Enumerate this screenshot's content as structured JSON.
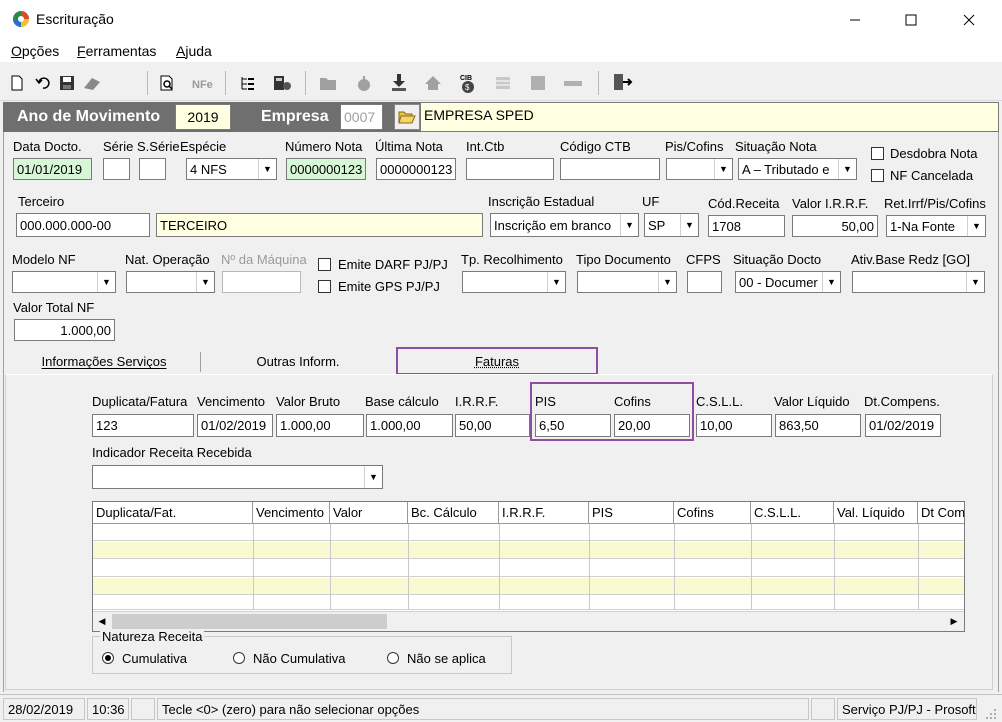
{
  "window": {
    "title": "Escrituração"
  },
  "menu": [
    {
      "label": "Opções",
      "accel": "O"
    },
    {
      "label": "Ferramentas",
      "accel": "F"
    },
    {
      "label": "Ajuda",
      "accel": "A"
    }
  ],
  "header": {
    "ano_label": "Ano de Movimento",
    "ano_value": "2019",
    "empresa_label": "Empresa",
    "empresa_code": "0007",
    "empresa_name": "EMPRESA SPED"
  },
  "row1": {
    "data_docto_label": "Data Docto.",
    "data_docto": "01/01/2019",
    "serie_label": "Série",
    "serie": "",
    "sserie_label": "S.Série",
    "sserie": "",
    "especie_label": "Espécie",
    "especie": "4 NFS",
    "numero_nota_label": "Número Nota",
    "numero_nota": "0000000123",
    "ultima_nota_label": "Última Nota",
    "ultima_nota": "0000000123",
    "int_ctb_label": "Int.Ctb",
    "int_ctb": "",
    "codigo_ctb_label": "Código CTB",
    "codigo_ctb": "",
    "pis_cofins_label": "Pis/Cofins",
    "pis_cofins": "",
    "situacao_nota_label": "Situação Nota",
    "situacao_nota": "A – Tributado e",
    "desdobra_label": "Desdobra Nota",
    "nf_cancelada_label": "NF Cancelada"
  },
  "row2": {
    "terceiro_label": "Terceiro",
    "terceiro_doc": "000.000.000-00",
    "terceiro_nome": "TERCEIRO",
    "insc_est_label": "Inscrição Estadual",
    "insc_est": "Inscrição em branco",
    "uf_label": "UF",
    "uf": "SP",
    "cod_receita_label": "Cód.Receita",
    "cod_receita": "1708",
    "valor_irrf_label": "Valor I.R.R.F.",
    "valor_irrf": "50,00",
    "ret_irrf_label": "Ret.Irrf/Pis/Cofins",
    "ret_irrf": "1-Na Fonte"
  },
  "row3": {
    "modelo_nf_label": "Modelo NF",
    "modelo_nf": "",
    "nat_operacao_label": "Nat. Operação",
    "nat_operacao": "",
    "n_maquina_label": "Nº da Máquina",
    "n_maquina": "",
    "emite_darf_label": "Emite DARF PJ/PJ",
    "emite_gps_label": "Emite GPS PJ/PJ",
    "tp_recolhimento_label": "Tp. Recolhimento",
    "tp_recolhimento": "",
    "tipo_documento_label": "Tipo Documento",
    "tipo_documento": "",
    "cfps_label": "CFPS",
    "cfps": "",
    "situacao_docto_label": "Situação Docto",
    "situacao_docto": "00 - Documer",
    "ativ_base_label": "Ativ.Base Redz [GO]",
    "ativ_base": ""
  },
  "row4": {
    "valor_total_label": "Valor Total NF",
    "valor_total": "1.000,00"
  },
  "tabs": [
    {
      "label": "Informações Serviços",
      "accel_index": 0
    },
    {
      "label": "Outras Inform.",
      "accel_index": 0
    },
    {
      "label": "Faturas",
      "accel_index": 0
    }
  ],
  "faturas": {
    "duplicata_label": "Duplicata/Fatura",
    "duplicata": "123",
    "vencimento_label": "Vencimento",
    "vencimento": "01/02/2019",
    "valor_bruto_label": "Valor Bruto",
    "valor_bruto": "1.000,00",
    "base_calculo_label": "Base cálculo",
    "base_calculo": "1.000,00",
    "irrf_label": "I.R.R.F.",
    "irrf": "50,00",
    "pis_label": "PIS",
    "pis": "6,50",
    "cofins_label": "Cofins",
    "cofins": "20,00",
    "csll_label": "C.S.L.L.",
    "csll": "10,00",
    "valor_liquido_label": "Valor Líquido",
    "valor_liquido": "863,50",
    "dt_compens_label": "Dt.Compens.",
    "dt_compens": "01/02/2019",
    "indicador_label": "Indicador Receita Recebida",
    "indicador": ""
  },
  "grid": {
    "columns": [
      "Duplicata/Fat.",
      "Vencimento",
      "Valor",
      "Bc. Cálculo",
      "I.R.R.F.",
      "PIS",
      "Cofins",
      "C.S.L.L.",
      "Val. Líquido",
      "Dt Com"
    ]
  },
  "natureza": {
    "label": "Natureza Receita",
    "options": [
      "Cumulativa",
      "Não Cumulativa",
      "Não se aplica"
    ],
    "selected": 0
  },
  "status": {
    "date": "28/02/2019",
    "time": "10:36",
    "message": "Tecle <0> (zero) para não selecionar opções",
    "module": "Serviço PJ/PJ - Prosoft"
  },
  "colors": {
    "header_band": "#6f6f6f",
    "highlight": "#8e4fa0",
    "yellow_field": "#ffffe1",
    "green_field": "#d7f7d7",
    "grid_alt_row": "#fafad2"
  }
}
